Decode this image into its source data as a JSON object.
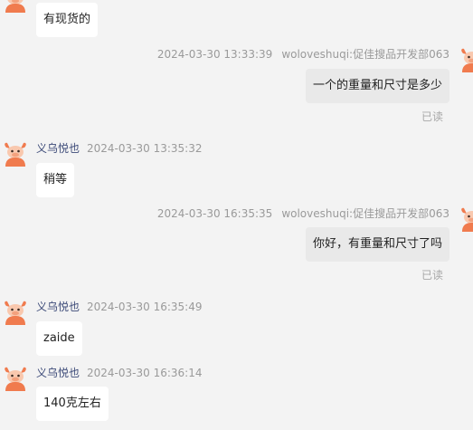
{
  "colors": {
    "background": "#f3f3f3",
    "incoming_bubble": "#ffffff",
    "outgoing_bubble": "#e9e9e9",
    "sender_name": "#3c4a78",
    "timestamp": "#9a9a9a",
    "avatar_main": "#f07b4e"
  },
  "messages": [
    {
      "direction": "incoming",
      "sender": "",
      "time": "",
      "text": "有现货的",
      "status": ""
    },
    {
      "direction": "outgoing",
      "sender": "woloveshuqi:促佳搜品开发部063",
      "time": "2024-03-30 13:33:39",
      "text": "一个的重量和尺寸是多少",
      "status": "已读"
    },
    {
      "direction": "incoming",
      "sender": "义乌悦也",
      "time": "2024-03-30 13:35:32",
      "text": "稍等",
      "status": ""
    },
    {
      "direction": "outgoing",
      "sender": "woloveshuqi:促佳搜品开发部063",
      "time": "2024-03-30 16:35:35",
      "text": "你好，有重量和尺寸了吗",
      "status": "已读"
    },
    {
      "direction": "incoming",
      "sender": "义乌悦也",
      "time": "2024-03-30 16:35:49",
      "text": "zaide",
      "status": ""
    },
    {
      "direction": "incoming",
      "sender": "义乌悦也",
      "time": "2024-03-30 16:36:14",
      "text": "140克左右",
      "status": ""
    }
  ]
}
